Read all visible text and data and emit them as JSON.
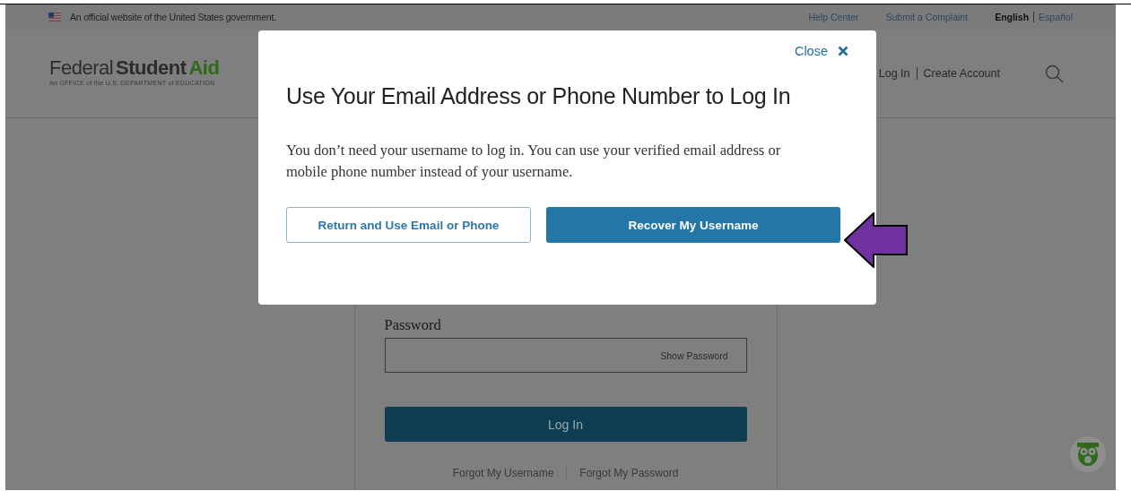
{
  "banner": {
    "text": "An official website of the United States government.",
    "links": [
      {
        "label": "Help Center"
      },
      {
        "label": "Submit a Complaint"
      }
    ],
    "languages": [
      {
        "label": "English",
        "selected": true
      },
      {
        "label": "Español",
        "selected": false
      }
    ]
  },
  "header": {
    "logo": {
      "part_1": "Federal",
      "part_2": "Student",
      "part_3": "Aid",
      "tagline": "An OFFICE of the U.S. DEPARTMENT of EDUCATION"
    },
    "account_links": [
      "Log In",
      "Create Account"
    ]
  },
  "login_form": {
    "password_label": "Password",
    "show_password": "Show Password",
    "submit": "Log In",
    "links": [
      "Forgot My Username",
      "Forgot My Password"
    ]
  },
  "modal": {
    "close": "Close",
    "title": "Use Your Email Address or Phone Number to Log In",
    "body": "You don’t need your username to log in. You can use your verified email address or mobile phone number instead of your username.",
    "buttons": [
      {
        "label": "Return and Use Email or Phone",
        "kind": "secondary"
      },
      {
        "label": "Recover My Username",
        "kind": "primary"
      }
    ]
  }
}
